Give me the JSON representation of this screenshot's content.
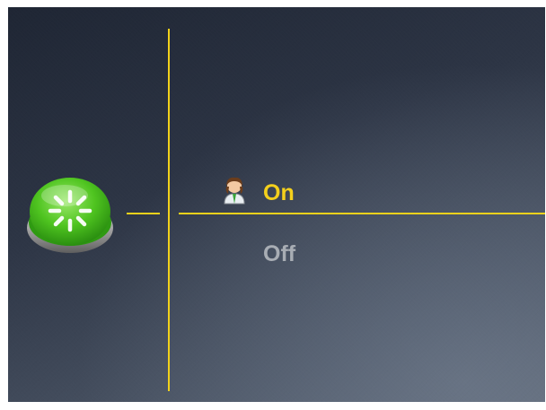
{
  "menu": {
    "options": [
      {
        "label": "On",
        "selected": true,
        "icon": "user-avatar-icon"
      },
      {
        "label": "Off",
        "selected": false
      }
    ]
  },
  "power_button": {
    "icon": "power-loading-icon",
    "color": "#5cc92e"
  },
  "colors": {
    "accent": "#f2d21b",
    "inactive_text": "#a8adb4",
    "background_dark": "#1f2634",
    "background_light": "#5b6574"
  }
}
